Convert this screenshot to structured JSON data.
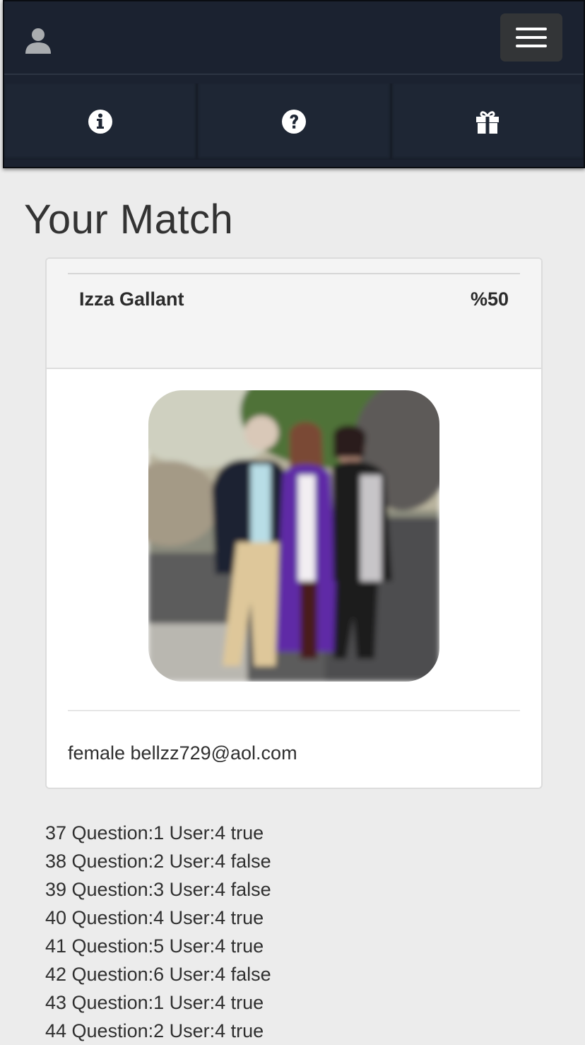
{
  "header": {
    "profile_icon": "user-silhouette-icon",
    "menu_icon": "hamburger-menu-icon",
    "nav_tabs": [
      {
        "icon": "info-circle-icon"
      },
      {
        "icon": "question-circle-icon"
      },
      {
        "icon": "gift-icon"
      }
    ]
  },
  "page": {
    "title": "Your Match"
  },
  "match": {
    "name": "Izza Gallant",
    "percent": "%50",
    "info": "female bellzz729@aol.com"
  },
  "answers": [
    "37 Question:1 User:4 true",
    "38 Question:2 User:4 false",
    "39 Question:3 User:4 false",
    "40 Question:4 User:4 true",
    "41 Question:5 User:4 true",
    "42 Question:6 User:4 false",
    "43 Question:1 User:4 true",
    "44 Question:2 User:4 true"
  ],
  "colors": {
    "header_bg": "#1b2230",
    "page_bg": "#ececec",
    "card_head_bg": "#f4f4f4",
    "menu_button_bg": "#333537"
  }
}
